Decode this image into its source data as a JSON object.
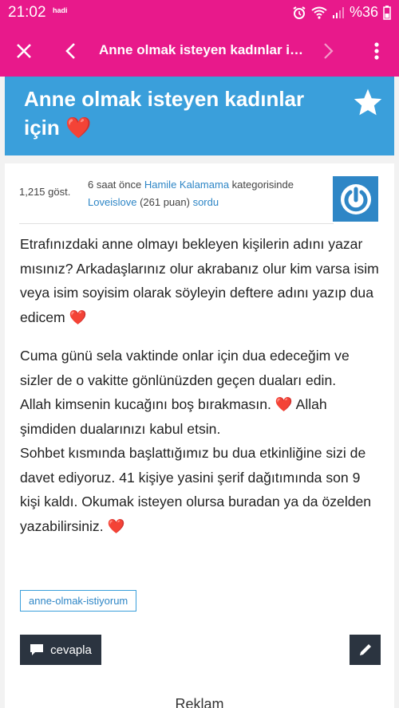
{
  "status_bar": {
    "time": "21:02",
    "carrier": "hadi",
    "battery": "%36",
    "icons": [
      "alarm-icon",
      "wifi-icon",
      "signal-icon",
      "battery-icon"
    ]
  },
  "app_bar": {
    "title": "Anne olmak isteyen kadınlar için...",
    "icons": [
      "close-icon",
      "back-arrow-icon",
      "forward-arrow-icon",
      "more-vertical-icon"
    ]
  },
  "question": {
    "title": "Anne olmak isteyen kadınlar için",
    "title_emoji": "❤️",
    "views": "1,215 göst.",
    "time_ago": "6 saat önce",
    "category": "Hamile Kalamama",
    "category_suffix": "kategorisinde",
    "author": "Loveislove",
    "author_points": "(261 puan)",
    "action": "sordu",
    "paragraphs": [
      "Etrafınızdaki anne olmayı bekleyen kişilerin adını yazar mısınız? Arkadaşlarınız olur akrabanız olur kim varsa isim veya isim soyisim olarak söyleyin deftere adını yazıp dua edicem ❤️",
      "Cuma günü sela vaktinde onlar için dua edeceğim ve sizler de o vakitte gönlünüzden geçen duaları edin.",
      "Allah kimsenin kucağını boş bırakmasın. ❤️ Allah şimdiden dualarınızı kabul etsin.",
      "Sohbet kısmında başlattığımız bu dua etkinliğine sizi de davet ediyoruz. 41 kişiye yasini şerif dağıtımında son 9 kişi kaldı. Okumak isteyen olursa buradan ya da özelden yazabilirsiniz. ❤️"
    ],
    "tag": "anne-olmak-istiyorum"
  },
  "actions": {
    "reply_label": "cevapla"
  },
  "ad_label": "Reklam",
  "colors": {
    "brand_pink": "#e8198b",
    "header_blue": "#3a9fdb",
    "link_blue": "#2e86c6",
    "dark_button": "#2b3440",
    "heart_red": "#e0162b"
  }
}
